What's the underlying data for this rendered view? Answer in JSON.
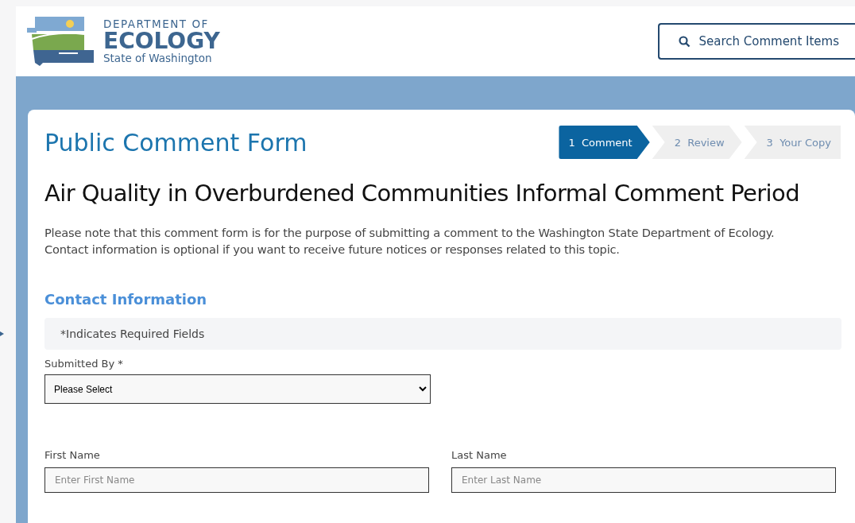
{
  "header": {
    "logo": {
      "line_1": "DEPARTMENT OF",
      "line_2": "ECOLOGY",
      "line_3": "State of Washington"
    },
    "search_button": "Search Comment Items"
  },
  "form": {
    "title": "Public Comment Form",
    "steps": [
      {
        "number": "1",
        "label": "Comment",
        "selected": true
      },
      {
        "number": "2",
        "label": "Review",
        "selected": false
      },
      {
        "number": "3",
        "label": "Your Copy",
        "selected": false
      }
    ],
    "heading": "Air Quality in Overburdened Communities Informal Comment Period",
    "intro": "Please note that this comment form is for the purpose of submitting a comment to the Washington State Department of Ecology. Contact information is optional if you want to receive future notices or responses related to this topic.",
    "section_title": "Contact Information",
    "required_note": "*Indicates Required Fields",
    "submitted_by": {
      "label": "Submitted By *",
      "value": "Please Select"
    },
    "fields": [
      {
        "label": "First Name",
        "placeholder": "Enter First Name"
      },
      {
        "label": "Last Name",
        "placeholder": "Enter Last Name"
      }
    ]
  }
}
